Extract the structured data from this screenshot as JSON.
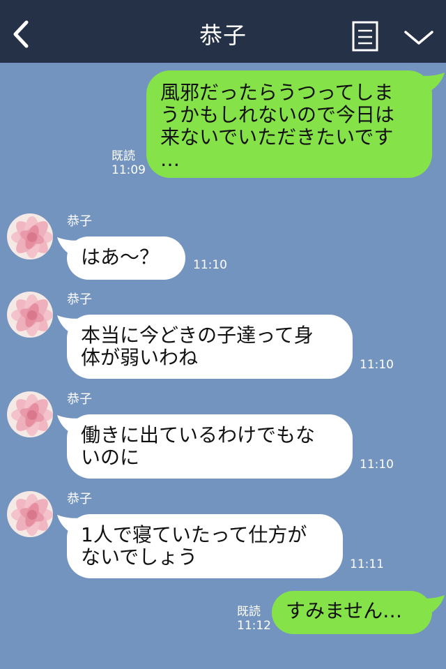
{
  "header": {
    "back_icon": "chevron-left-icon",
    "title": "恭子",
    "note_icon": "note-icon",
    "menu_icon": "chevron-down-icon",
    "bg_color": "#253147"
  },
  "chat": {
    "bg_color": "#7494c0",
    "sent_bubble_color": "#85e249",
    "recv_bubble_color": "#ffffff",
    "messages": [
      {
        "direction": "sent",
        "text": "風邪だったらうつってしま\nうかもしれないので今日は\n来ないでいただきたいです\n…",
        "read_label": "既読",
        "time": "11:09"
      },
      {
        "direction": "received",
        "sender": "恭子",
        "avatar_icon": "flower-avatar-icon",
        "text": "はあ～？",
        "time": "11:10"
      },
      {
        "direction": "received",
        "sender": "恭子",
        "avatar_icon": "flower-avatar-icon",
        "text": "本当に今どきの子達って身\n体が弱いわね",
        "time": "11:10"
      },
      {
        "direction": "received",
        "sender": "恭子",
        "avatar_icon": "flower-avatar-icon",
        "text": "働きに出ているわけでもな\nいのに",
        "time": "11:10"
      },
      {
        "direction": "received",
        "sender": "恭子",
        "avatar_icon": "flower-avatar-icon",
        "text": "1人で寝ていたって仕方が\nないでしょう",
        "time": "11:11"
      },
      {
        "direction": "sent",
        "text": "すみません…",
        "read_label": "既読",
        "time": "11:12"
      }
    ]
  }
}
